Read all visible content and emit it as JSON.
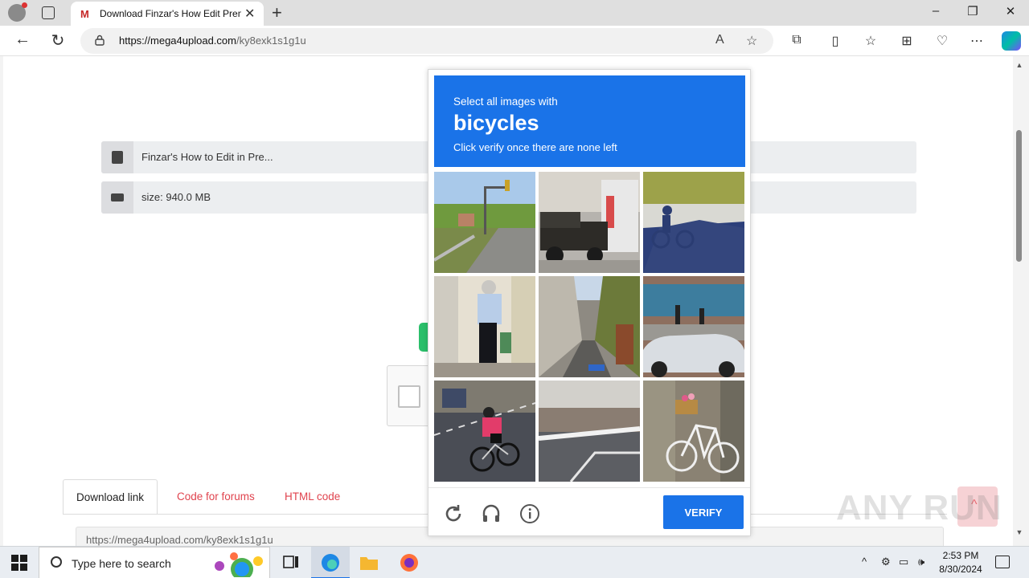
{
  "browser": {
    "tab_title": "Download Finzar's How Edit Pren",
    "tab_favicon": "M",
    "url_host": "https://mega4upload.com",
    "url_path": "/ky8exk1s1g1u",
    "new_tab_icon": "+",
    "close_tab_icon": "✕"
  },
  "page": {
    "file_name": "Finzar's How to Edit in Pre...",
    "file_size": "size: 940.0 MB",
    "tabs": [
      "Download link",
      "Code for forums",
      "HTML code"
    ],
    "download_url": "https://mega4upload.com/ky8exk1s1g1u",
    "watermark": "ANY RUN",
    "scroll_up_icon": "^"
  },
  "captcha": {
    "prompt_line": "Select all images with",
    "target": "bicycles",
    "instruction": "Click verify once there are none left",
    "verify_label": "VERIFY",
    "tiles": [
      "traffic-light-road",
      "truck-trailer",
      "bicycle-shadow",
      "man-at-door",
      "narrow-street",
      "parked-cars",
      "cyclist-road",
      "road-curb",
      "bicycle-basket"
    ]
  },
  "taskbar": {
    "search_placeholder": "Type here to search",
    "time": "2:53 PM",
    "date": "8/30/2024"
  },
  "colors": {
    "accent": "#1a73e8",
    "link_red": "#e0434e",
    "green": "#2bbf6a"
  }
}
